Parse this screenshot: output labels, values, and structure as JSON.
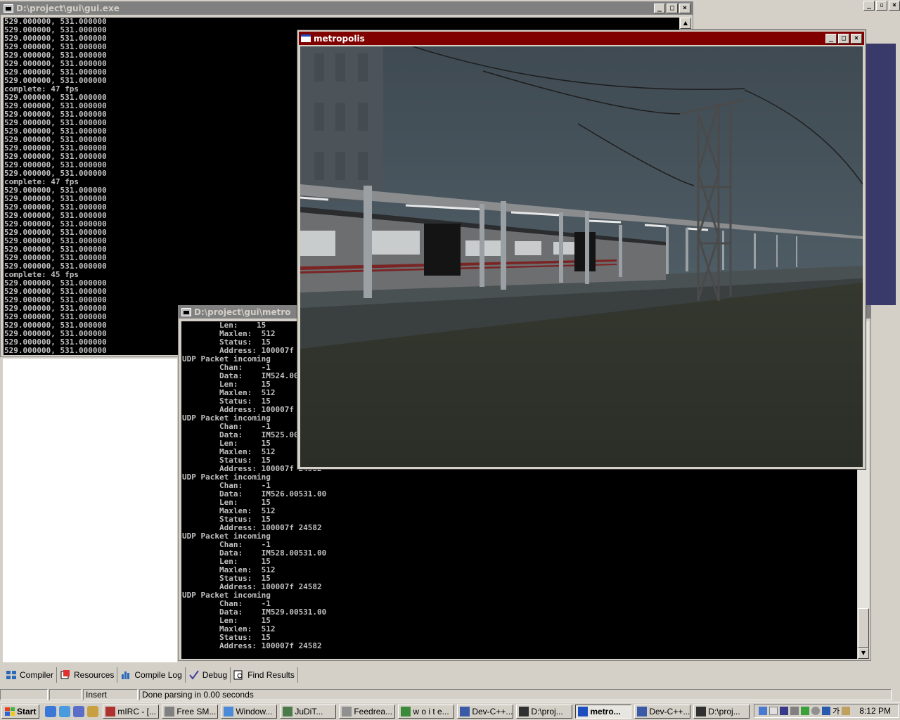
{
  "devcpp": {
    "caption_buttons": [
      "_",
      "▫",
      "×"
    ],
    "tabs": [
      {
        "label": "Compiler",
        "icon": "grid-icon"
      },
      {
        "label": "Resources",
        "icon": "resources-icon"
      },
      {
        "label": "Compile Log",
        "icon": "bar-chart-icon"
      },
      {
        "label": "Debug",
        "icon": "checkmark-icon"
      },
      {
        "label": "Find Results",
        "icon": "find-icon"
      }
    ],
    "status": {
      "insert": "Insert",
      "message": "Done parsing in 0.00 seconds"
    }
  },
  "console1": {
    "title": "D:\\project\\gui\\gui.exe",
    "caption_buttons": [
      "_",
      "□",
      "×"
    ],
    "lines": [
      "529.000000, 531.000000",
      "529.000000, 531.000000",
      "529.000000, 531.000000",
      "529.000000, 531.000000",
      "529.000000, 531.000000",
      "529.000000, 531.000000",
      "529.000000, 531.000000",
      "529.000000, 531.000000",
      "complete: 47 fps",
      "529.000000, 531.000000",
      "529.000000, 531.000000",
      "529.000000, 531.000000",
      "529.000000, 531.000000",
      "529.000000, 531.000000",
      "529.000000, 531.000000",
      "529.000000, 531.000000",
      "529.000000, 531.000000",
      "529.000000, 531.000000",
      "529.000000, 531.000000",
      "complete: 47 fps",
      "529.000000, 531.000000",
      "529.000000, 531.000000",
      "529.000000, 531.000000",
      "529.000000, 531.000000",
      "529.000000, 531.000000",
      "529.000000, 531.000000",
      "529.000000, 531.000000",
      "529.000000, 531.000000",
      "529.000000, 531.000000",
      "529.000000, 531.000000",
      "complete: 45 fps",
      "529.000000, 531.000000",
      "529.000000, 531.000000",
      "529.000000, 531.000000",
      "529.000000, 531.000000",
      "529.000000, 531.000000",
      "529.000000, 531.000000",
      "529.000000, 531.000000",
      "529.000000, 531.000000",
      "529.000000, 531.000000"
    ]
  },
  "console2": {
    "title": "D:\\project\\gui\\metro",
    "lines": [
      "        Len:    15",
      "        Maxlen:  512",
      "        Status:  15",
      "        Address: 100007f 24582",
      "UDP Packet incoming",
      "        Chan:    -1",
      "        Data:    IM524.00531.00",
      "        Len:     15",
      "        Maxlen:  512",
      "        Status:  15",
      "        Address: 100007f 24582",
      "UDP Packet incoming",
      "        Chan:    -1",
      "        Data:    IM525.00531.00",
      "        Len:     15",
      "        Maxlen:  512",
      "        Status:  15",
      "        Address: 100007f 24582",
      "UDP Packet incoming",
      "        Chan:    -1",
      "        Data:    IM526.00531.00",
      "        Len:     15",
      "        Maxlen:  512",
      "        Status:  15",
      "        Address: 100007f 24582",
      "UDP Packet incoming",
      "        Chan:    -1",
      "        Data:    IM528.00531.00",
      "        Len:     15",
      "        Maxlen:  512",
      "        Status:  15",
      "        Address: 100007f 24582",
      "UDP Packet incoming",
      "        Chan:    -1",
      "        Data:    IM529.00531.00",
      "        Len:     15",
      "        Maxlen:  512",
      "        Status:  15",
      "        Address: 100007f 24582"
    ]
  },
  "metropolis": {
    "title": "metropolis",
    "caption_buttons": [
      "_",
      "□",
      "×"
    ]
  },
  "taskbar": {
    "start_label": "Start",
    "items": [
      {
        "label": "mIRC - [...",
        "icon": "mirc-icon",
        "active": false
      },
      {
        "label": "Free SM...",
        "icon": "sms-icon",
        "active": false
      },
      {
        "label": "Window...",
        "icon": "window-icon",
        "active": false
      },
      {
        "label": "JuDiT...",
        "icon": "judit-icon",
        "active": false
      },
      {
        "label": "Feedrea...",
        "icon": "feed-icon",
        "active": false
      },
      {
        "label": "w o i t e...",
        "icon": "woite-icon",
        "active": false
      },
      {
        "label": "Dev-C++...",
        "icon": "devcpp-icon",
        "active": false
      },
      {
        "label": "D:\\proj...",
        "icon": "console-icon",
        "active": false
      },
      {
        "label": "metro...",
        "icon": "metro-icon",
        "active": true
      },
      {
        "label": "Dev-C++...",
        "icon": "devcpp-icon",
        "active": false
      },
      {
        "label": "D:\\proj...",
        "icon": "console-icon",
        "active": false
      }
    ],
    "ime": "가",
    "clock": "8:12 PM"
  },
  "colors": {
    "active_title": "#800000",
    "inactive_title": "#808080",
    "desktop_face": "#d4d0c8",
    "right_panel": "#3a3a6a"
  }
}
